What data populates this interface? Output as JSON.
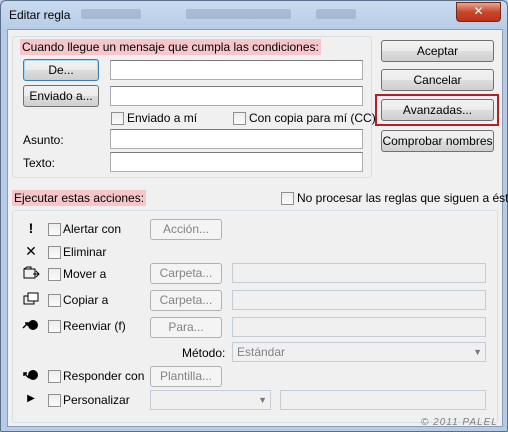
{
  "window": {
    "title": "Editar regla",
    "close": "✕"
  },
  "conditions": {
    "header": "Cuando llegue un mensaje que cumpla las condiciones:",
    "from_button": "De...",
    "sent_to_button": "Enviado a...",
    "sent_to_me": "Enviado a mí",
    "cc_to_me": "Con copia para mí (CC)",
    "subject_label": "Asunto:",
    "text_label": "Texto:"
  },
  "side_buttons": {
    "accept": "Aceptar",
    "cancel": "Cancelar",
    "advanced": "Avanzadas...",
    "check_names": "Comprobar nombres"
  },
  "actions": {
    "header": "Ejecutar estas acciones:",
    "no_more_rules": "No procesar las reglas que siguen a ésta",
    "alert_with": "Alertar con",
    "alert_button": "Acción...",
    "delete": "Eliminar",
    "move_to": "Mover a",
    "move_button": "Carpeta...",
    "copy_to": "Copiar a",
    "copy_button": "Carpeta...",
    "forward": "Reenviar (f)",
    "forward_button": "Para...",
    "method_label": "Método:",
    "method_value": "Estándar",
    "reply_with": "Responder con",
    "reply_button": "Plantilla...",
    "customize": "Personalizar"
  },
  "icons": {
    "alert": "exclamation-icon",
    "delete": "x-icon",
    "move": "move-folder-icon",
    "copy": "copy-folder-icon",
    "forward": "forward-icon",
    "reply": "reply-icon",
    "customize": "triangle-right-icon"
  },
  "colors": {
    "highlight": "#f7c6cb",
    "red_outline": "#b21f24"
  },
  "watermark": "© 2011 PALEL"
}
